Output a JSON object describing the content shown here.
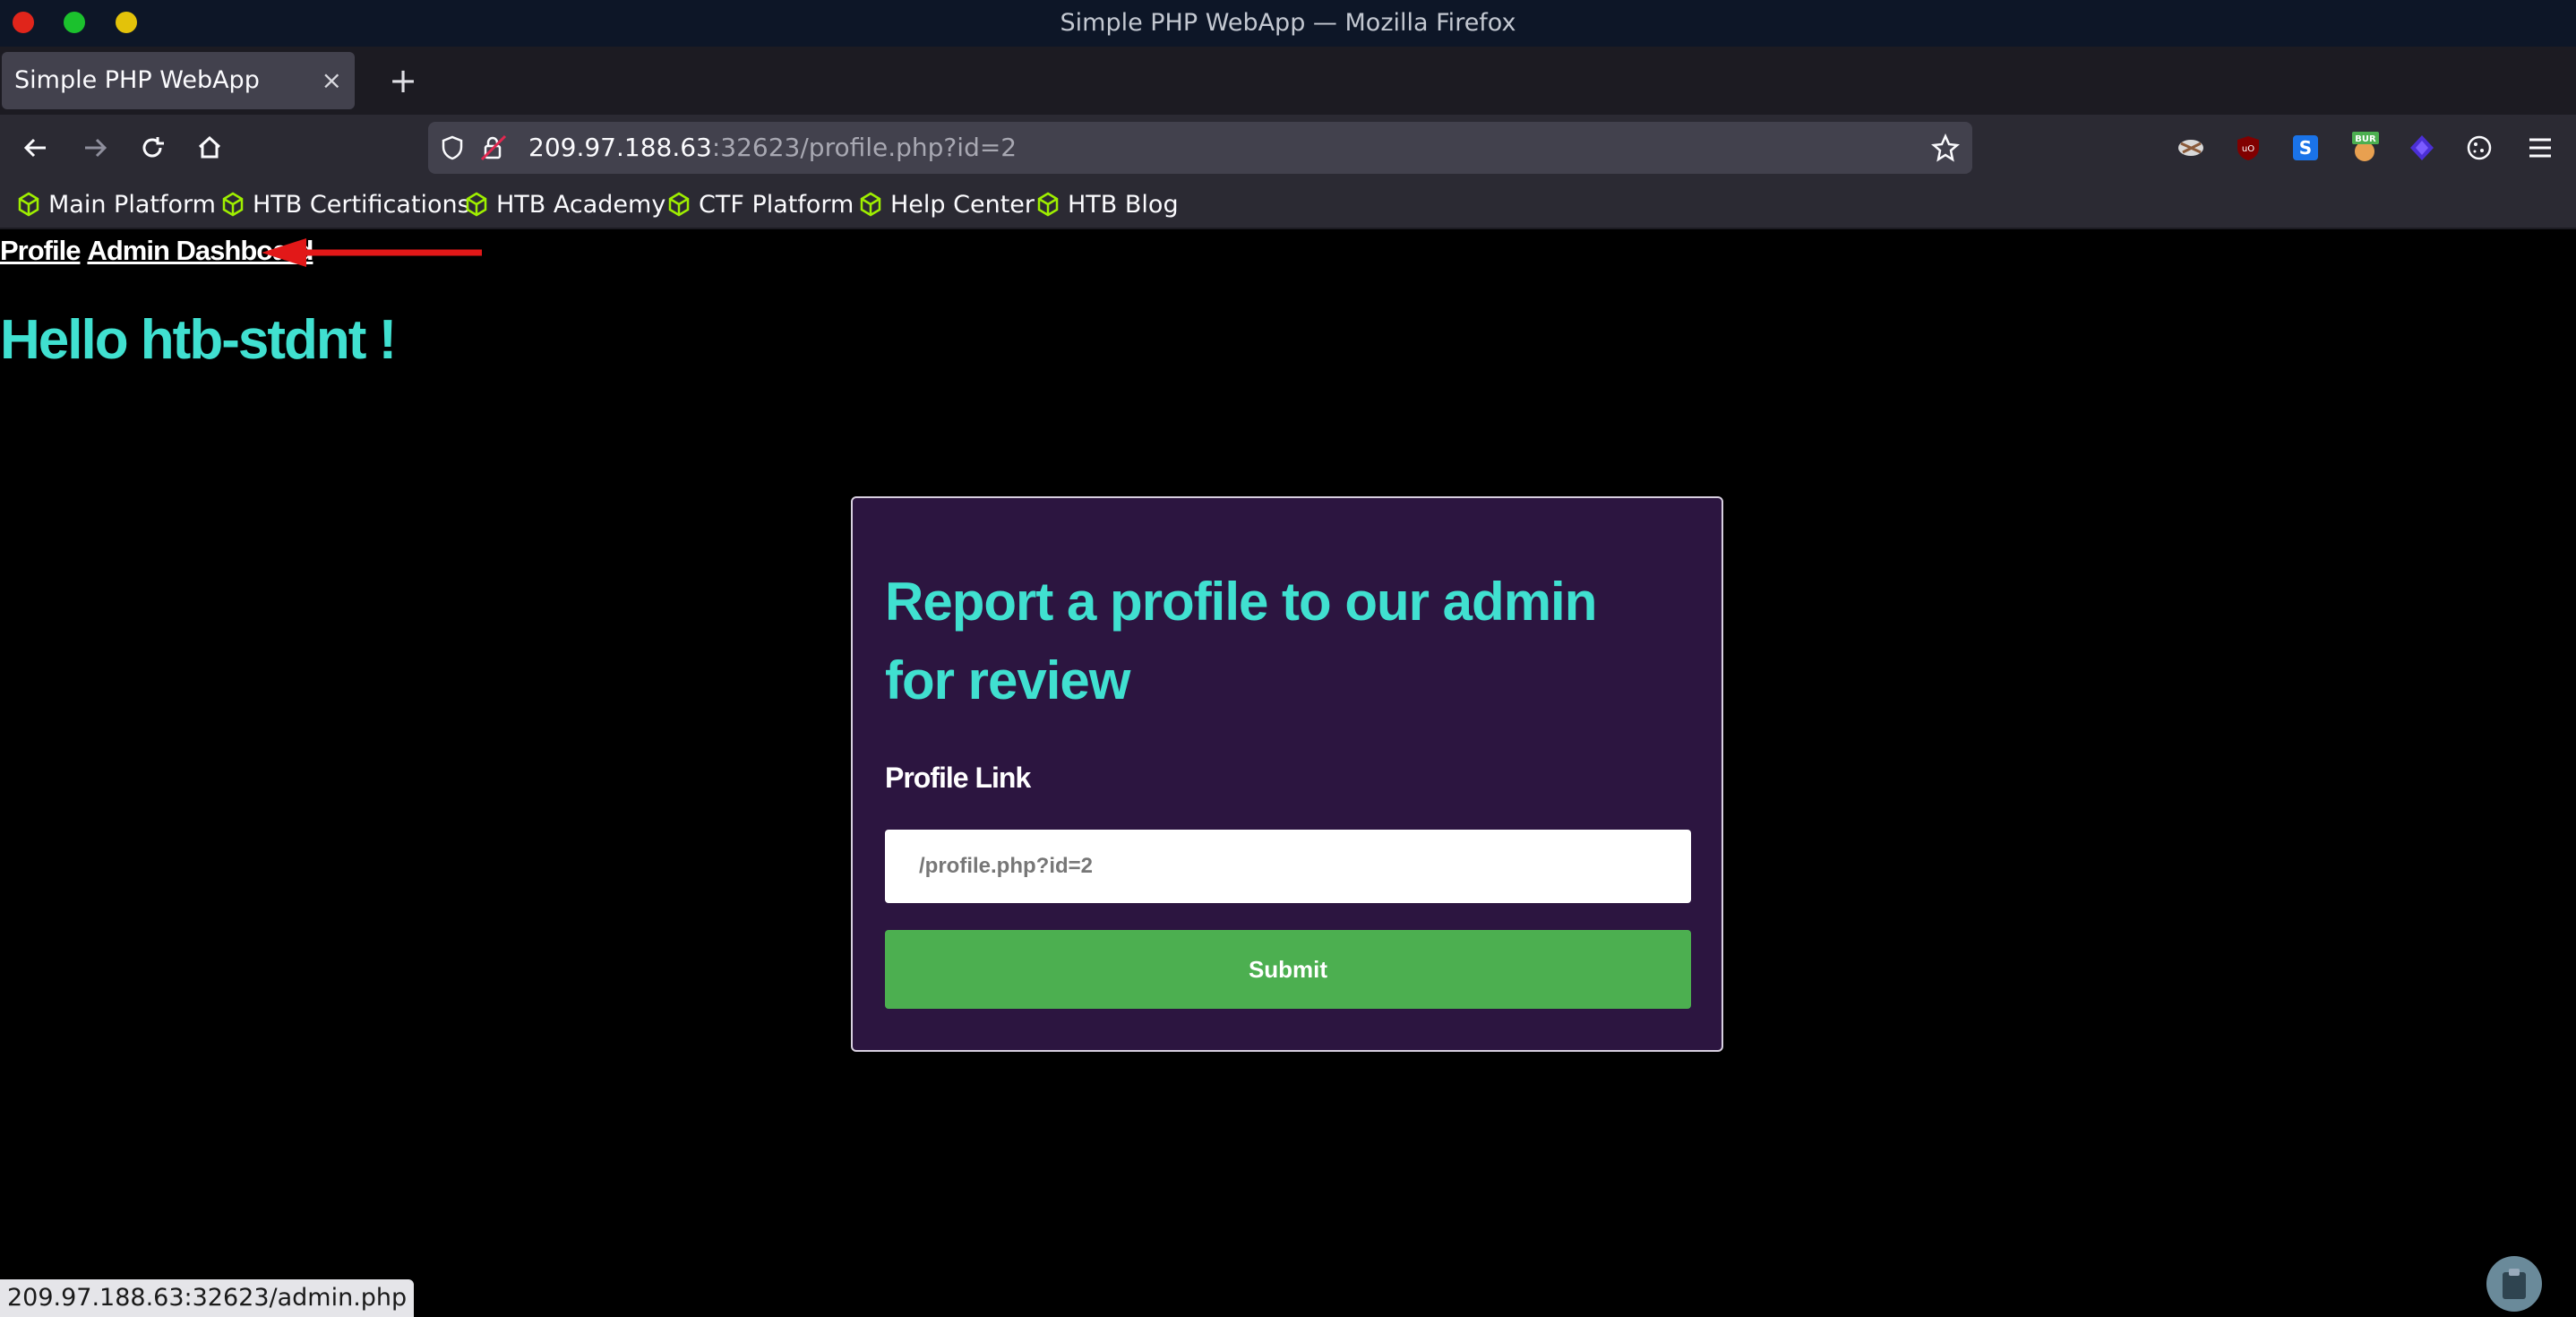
{
  "window": {
    "title": "Simple PHP WebApp — Mozilla Firefox",
    "buttons": [
      {
        "name": "close",
        "color": "#e0251b"
      },
      {
        "name": "maximize",
        "color": "#1bc12d"
      },
      {
        "name": "minimize",
        "color": "#e3c20a"
      }
    ]
  },
  "tab": {
    "label": "Simple PHP WebApp",
    "close": "×",
    "new": "+"
  },
  "url": {
    "host": "209.97.188.63",
    "rest": ":32623/profile.php?id=2"
  },
  "extensions": [
    "tracker-icon",
    "ublock-icon",
    "s-extension-icon",
    "burp-icon",
    "wappalyzer-icon",
    "cookie-icon"
  ],
  "extension_badge": "BUR",
  "bookmarks": [
    "Main Platform",
    "HTB Certifications",
    "HTB Academy",
    "CTF Platform",
    "Help Center",
    "HTB Blog"
  ],
  "page": {
    "nav": {
      "profile": "Profile",
      "admin": "Admin Dashboard"
    },
    "greeting": "Hello htb-stdnt !",
    "card": {
      "heading": "Report a profile to our admin for review",
      "label": "Profile Link",
      "input_placeholder": "/profile.php?id=2",
      "submit": "Submit"
    }
  },
  "status_url": "209.97.188.63:32623/admin.php",
  "colors": {
    "accent": "#40e0d0",
    "card_bg": "#2c1540",
    "submit_bg": "#4caf50",
    "bookmark_icon": "#9fef00"
  }
}
